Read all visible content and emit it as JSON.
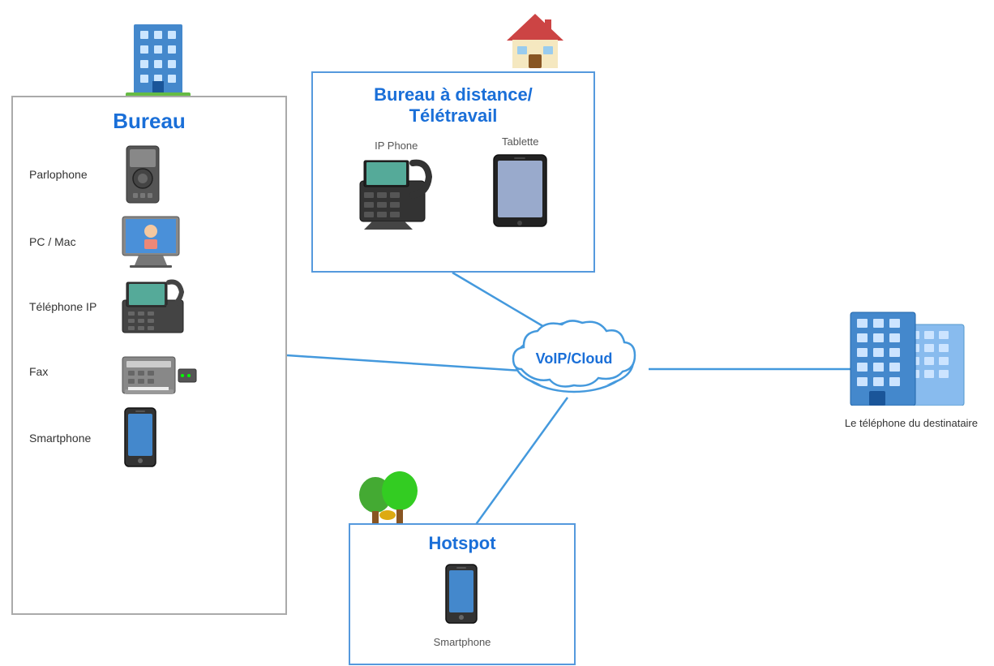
{
  "bureau": {
    "title": "Bureau",
    "items": [
      {
        "label": "Parlophone",
        "icon": "parlophone"
      },
      {
        "label": "PC / Mac",
        "icon": "pc-mac"
      },
      {
        "label": "Téléphone IP",
        "icon": "telephone-ip"
      },
      {
        "label": "Fax",
        "icon": "fax"
      },
      {
        "label": "Smartphone",
        "icon": "smartphone"
      }
    ]
  },
  "remote": {
    "title": "Bureau à distance/\nTélétravail",
    "items": [
      {
        "label": "IP Phone",
        "icon": "ip-phone"
      },
      {
        "label": "Tablette",
        "icon": "tablet"
      }
    ]
  },
  "hotspot": {
    "title": "Hotspot",
    "items": [
      {
        "label": "Smartphone",
        "icon": "smartphone"
      }
    ]
  },
  "voip": {
    "label": "VoIP/Cloud"
  },
  "destination": {
    "label": "Le téléphone\ndu destinataire"
  },
  "colors": {
    "blue": "#1a6fd8",
    "line": "#4499dd"
  }
}
